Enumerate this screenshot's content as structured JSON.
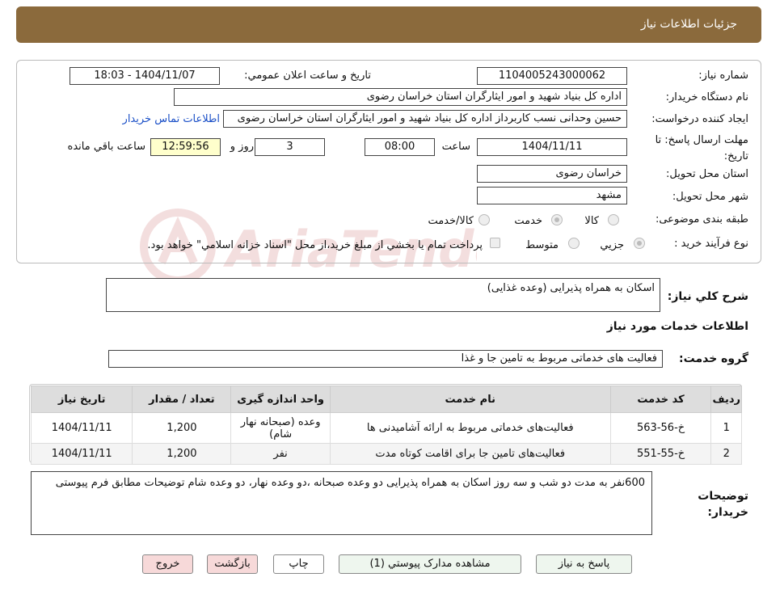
{
  "header": {
    "title": "جزئیات اطلاعات نیاز"
  },
  "labels": {
    "need_number": "شماره نیاز:",
    "announce_date": "تاریخ و ساعت اعلان عمومي:",
    "buyer_org": "نام دستگاه خريدار:",
    "requester": "ايجاد کننده درخواست:",
    "deadline": "مهلت ارسال پاسخ: تا تاريخ:",
    "hour": "ساعت",
    "days_and": "روز و",
    "remaining": "ساعت باقي مانده",
    "province": "استان محل تحويل:",
    "city": "شهر محل تحويل:",
    "category": "طبقه بندی موضوعی:",
    "purchase_type": "نوع فرآيند خريد :",
    "description": "شرح کلي نياز:",
    "services_info": "اطلاعات خدمات مورد نياز",
    "service_group": "گروه خدمت:",
    "buyer_notes": "توضیحات خریدار:"
  },
  "values": {
    "need_number": "1104005243000062",
    "announce_date": "1404/11/07 - 18:03",
    "buyer_org": "اداره کل بنیاد شهید و امور ایثارگران استان خراسان رضوی",
    "requester": "حسین وحدانی نسب کاربرداز اداره کل بنیاد شهید و امور ایثارگران استان خراسان رضوی",
    "contact_link": "اطلاعات تماس خريدار",
    "deadline_date": "1404/11/11",
    "deadline_time": "08:00",
    "days": "3",
    "remaining_time": "12:59:56",
    "province": "خراسان رضوی",
    "city": "مشهد",
    "description": "اسکان به همراه پذیرایی (وعده غذایی)",
    "service_group": "فعالیت های خدماتی مربوط به تامین جا و غذا",
    "buyer_notes": "600نفر به مدت  دو شب و سه روز اسکان به همراه پذیرایی دو وعده صبحانه ،دو وعده نهار، دو وعده شام توضیحات مطابق فرم پیوستی"
  },
  "category_options": [
    "کالا",
    "خدمت",
    "کالا/خدمت"
  ],
  "category_selected": "خدمت",
  "purchase_options": [
    "جزيي",
    "متوسط"
  ],
  "purchase_selected": "جزيي",
  "purchase_note": "پرداخت تمام يا بخشي از مبلغ خريد،از محل \"اسناد خزانه اسلامي\" خواهد بود.",
  "table": {
    "headers": [
      "رديف",
      "کد خدمت",
      "نام خدمت",
      "واحد اندازه گيری",
      "تعداد / مقدار",
      "تاريخ نياز"
    ],
    "rows": [
      [
        "1",
        "خ-56-563",
        "فعالیت‌های خدماتی مربوط به ارائه آشامیدنی ها",
        "وعده (صبحانه نهار شام)",
        "1,200",
        "1404/11/11"
      ],
      [
        "2",
        "خ-55-551",
        "فعالیت‌های تامین جا برای اقامت کوتاه مدت",
        "نفر",
        "1,200",
        "1404/11/11"
      ]
    ]
  },
  "buttons": {
    "reply": "پاسخ به نياز",
    "attachments": "مشاهده مدارک پيوستي (1)",
    "print": "چاپ",
    "back": "بازگشت",
    "exit": "خروج"
  },
  "colors": {
    "header_bg": "#8b6a3c",
    "link": "#1a4fc7",
    "highlight": "#ffffcc",
    "back_btn": "#f7d9d9"
  }
}
